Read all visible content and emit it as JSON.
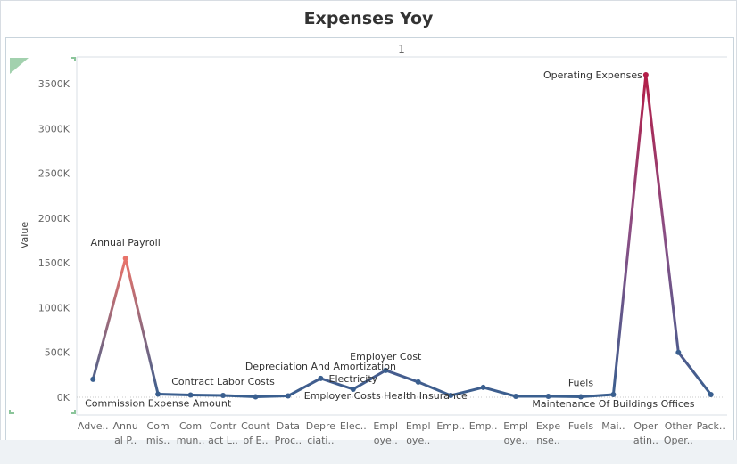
{
  "chart_data": {
    "type": "line",
    "title": "Expenses Yoy",
    "column_header": "1",
    "ylabel": "Value",
    "y_ticks": [
      "0K",
      "500K",
      "1000K",
      "1500K",
      "2000K",
      "2500K",
      "3000K",
      "3500K"
    ],
    "ylim": [
      0,
      3750
    ],
    "categories": [
      {
        "line1": "Adve..",
        "line2": ""
      },
      {
        "line1": "Annu",
        "line2": "al P.."
      },
      {
        "line1": "Com",
        "line2": "mis.."
      },
      {
        "line1": "Com",
        "line2": "mun.."
      },
      {
        "line1": "Contr",
        "line2": "act L.."
      },
      {
        "line1": "Count",
        "line2": "of E.."
      },
      {
        "line1": "Data",
        "line2": "Proc.."
      },
      {
        "line1": "Depre",
        "line2": "ciati.."
      },
      {
        "line1": "Elec..",
        "line2": ""
      },
      {
        "line1": "Empl",
        "line2": "oye.."
      },
      {
        "line1": "Empl",
        "line2": "oye.."
      },
      {
        "line1": "Emp..",
        "line2": ""
      },
      {
        "line1": "Emp..",
        "line2": ""
      },
      {
        "line1": "Empl",
        "line2": "oye.."
      },
      {
        "line1": "Expe",
        "line2": "nse.."
      },
      {
        "line1": "Fuels",
        "line2": ""
      },
      {
        "line1": "Mai..",
        "line2": ""
      },
      {
        "line1": "Oper",
        "line2": "atin.."
      },
      {
        "line1": "Other",
        "line2": "Oper.."
      },
      {
        "line1": "Pack..",
        "line2": ""
      }
    ],
    "values": [
      200,
      1550,
      35,
      25,
      20,
      5,
      15,
      210,
      90,
      300,
      170,
      20,
      110,
      10,
      10,
      5,
      30,
      3600,
      500,
      30
    ],
    "point_labels": [
      {
        "index": 1,
        "text": "Annual Payroll",
        "anchor": "middle",
        "dy": -14
      },
      {
        "index": 2,
        "text": "Commission Expense Amount",
        "anchor": "middle",
        "dy": 14
      },
      {
        "index": 4,
        "text": "Contract Labor Costs",
        "anchor": "middle",
        "dy": -12
      },
      {
        "index": 7,
        "text": "Depreciation And Amortization",
        "anchor": "middle",
        "dy": -10
      },
      {
        "index": 8,
        "text": "Electricity",
        "anchor": "middle",
        "dy": -8
      },
      {
        "index": 9,
        "text": "Employer Cost",
        "anchor": "middle",
        "dy": -12
      },
      {
        "index": 9,
        "text": "Employer Costs Health Insurance",
        "anchor": "middle",
        "dy": 32
      },
      {
        "index": 15,
        "text": "Fuels",
        "anchor": "middle",
        "dy": -12
      },
      {
        "index": 16,
        "text": "Maintenance Of Buildings Offices",
        "anchor": "middle",
        "dy": 14
      },
      {
        "index": 17,
        "text": "Operating Expenses",
        "anchor": "end",
        "dy": 4,
        "dx": -4
      }
    ],
    "colors": {
      "low": "#3a5f8f",
      "mid": "#8a4f85",
      "high": "#b31e48",
      "peak_annual": "#e8736a"
    }
  }
}
